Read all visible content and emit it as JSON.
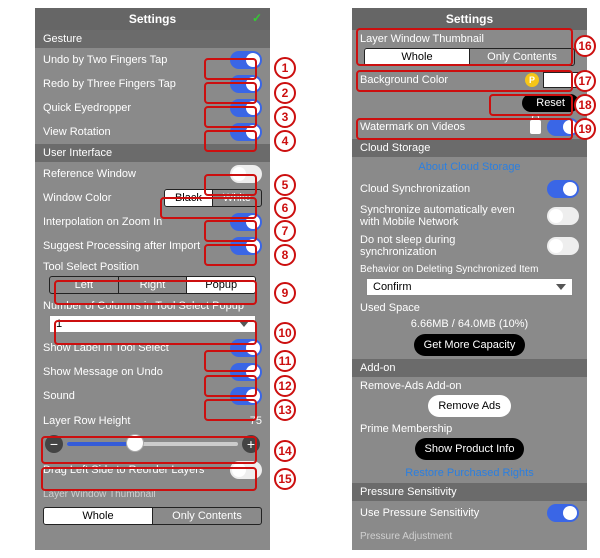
{
  "left": {
    "title": "Settings",
    "sections": {
      "gesture": {
        "header": "Gesture",
        "undo_label": "Undo by Two Fingers Tap",
        "redo_label": "Redo by Three Fingers Tap",
        "eyedropper_label": "Quick Eyedropper",
        "rotation_label": "View Rotation"
      },
      "ui": {
        "header": "User Interface",
        "refwin_label": "Reference Window",
        "wincolor_label": "Window Color",
        "wincolor_opts": {
          "black": "Black",
          "white": "White"
        },
        "interp_label": "Interpolation on Zoom In",
        "suggest_label": "Suggest Processing after Import",
        "toolpos_label": "Tool Select Position",
        "toolpos_opts": {
          "left": "Left",
          "right": "Right",
          "popup": "Popup"
        },
        "numcols_label": "Number of Columns in Tool Select Popup",
        "numcols_value": "1",
        "showlabel_label": "Show Label in Tool Select",
        "msgundo_label": "Show Message on Undo",
        "sound_label": "Sound",
        "rowheight_label": "Layer Row Height",
        "rowheight_value": "75",
        "drag_label": "Drag Left Side to Reorder Layers",
        "thumb_label": "Layer Window Thumbnail",
        "thumb_opts": {
          "whole": "Whole",
          "only": "Only Contents"
        }
      }
    }
  },
  "right": {
    "title": "Settings",
    "thumb_label": "Layer Window Thumbnail",
    "thumb_opts": {
      "whole": "Whole",
      "only": "Only Contents"
    },
    "bg_label": "Background Color",
    "reset_label": "Reset",
    "watermark_label": "Watermark on Videos",
    "cloud_header": "Cloud Storage",
    "about_cloud": "About Cloud Storage",
    "sync_label": "Cloud Synchronization",
    "autosync_label": "Synchronize automatically even with Mobile Network",
    "nosleep_label": "Do not sleep during synchronization",
    "behavior_label": "Behavior on Deleting Synchronized Item",
    "behavior_value": "Confirm",
    "used_label": "Used Space",
    "used_value": "6.66MB / 64.0MB (10%)",
    "getmore_label": "Get More Capacity",
    "addon_header": "Add-on",
    "removeads_add_label": "Remove-Ads Add-on",
    "removeads_btn": "Remove Ads",
    "prime_label": "Prime Membership",
    "showprod_btn": "Show Product Info",
    "restore_label": "Restore Purchased Rights",
    "pressure_header": "Pressure Sensitivity",
    "usepressure_label": "Use Pressure Sensitivity",
    "pressure_adj": "Pressure Adjustment"
  },
  "callouts": [
    "1",
    "2",
    "3",
    "4",
    "5",
    "6",
    "7",
    "8",
    "9",
    "10",
    "11",
    "12",
    "13",
    "14",
    "15",
    "16",
    "17",
    "18",
    "19"
  ]
}
